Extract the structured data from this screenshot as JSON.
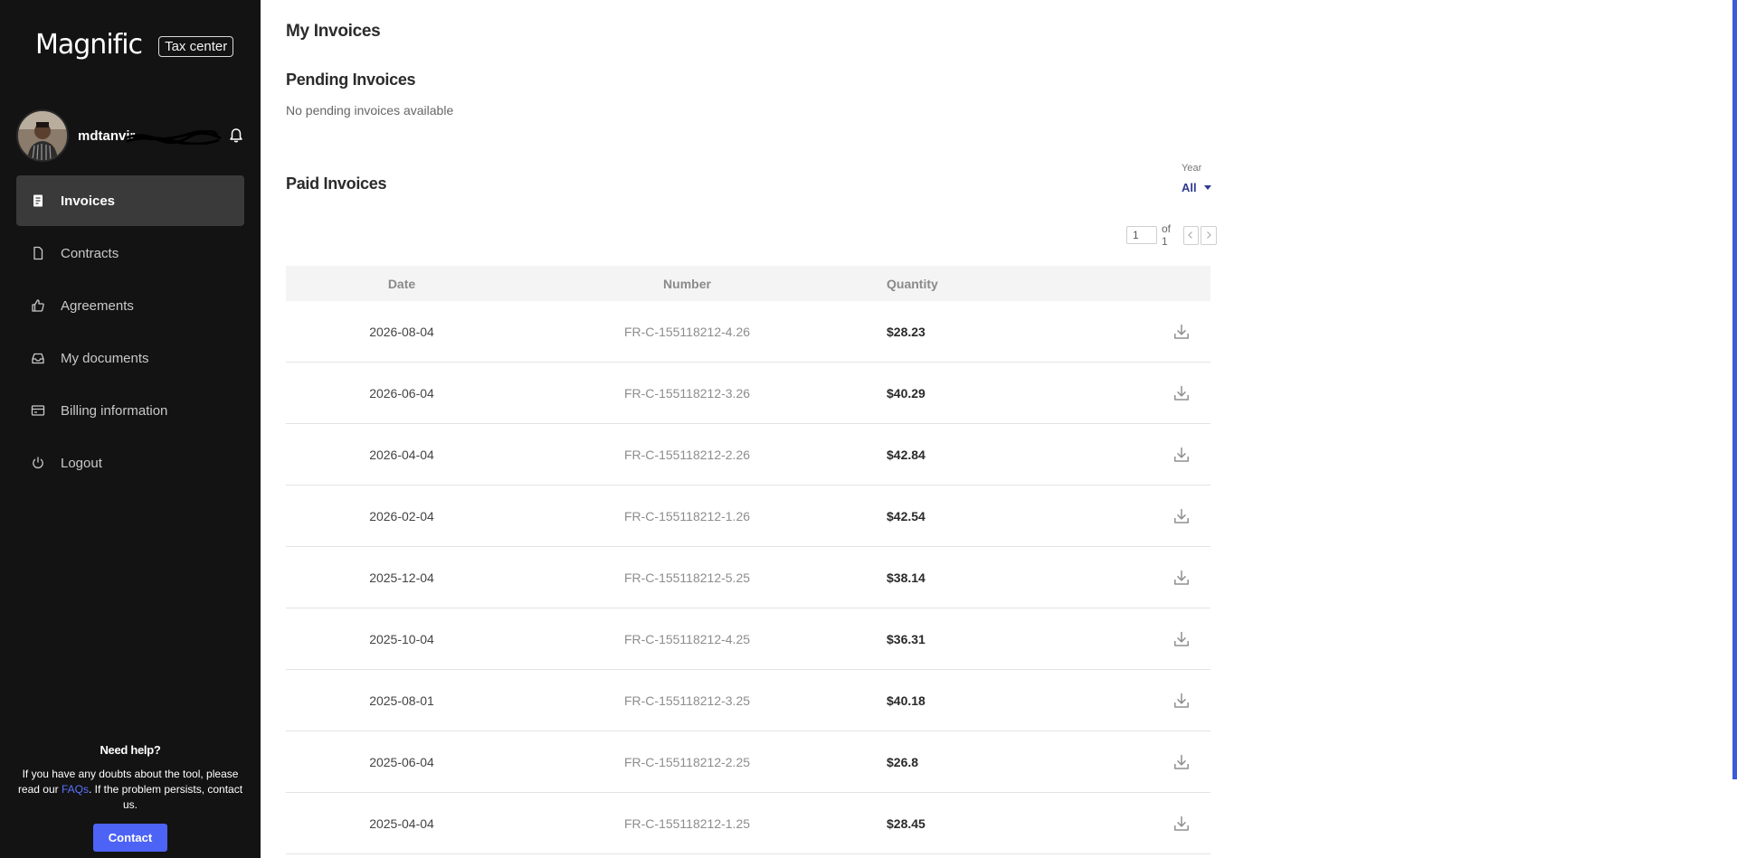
{
  "sidebar": {
    "brand": "Magnific",
    "badge": "Tax center",
    "user": {
      "name": "mdtanvir"
    },
    "nav": [
      {
        "label": "Invoices",
        "icon": "invoice-icon",
        "active": true
      },
      {
        "label": "Contracts",
        "icon": "document-icon",
        "active": false
      },
      {
        "label": "Agreements",
        "icon": "thumbs-up-icon",
        "active": false
      },
      {
        "label": "My documents",
        "icon": "inbox-icon",
        "active": false
      },
      {
        "label": "Billing information",
        "icon": "card-icon",
        "active": false
      },
      {
        "label": "Logout",
        "icon": "power-icon",
        "active": false
      }
    ],
    "help": {
      "title": "Need help?",
      "text_before": "If you have any doubts about the tool, please read our ",
      "faq_link": "FAQs",
      "text_after": ". If the problem persists, contact us.",
      "contact_button": "Contact"
    }
  },
  "main": {
    "title": "My Invoices",
    "pending": {
      "title": "Pending Invoices",
      "empty_text": "No pending invoices available"
    },
    "paid": {
      "title": "Paid Invoices",
      "year_filter": {
        "label": "Year",
        "value": "All"
      },
      "pager": {
        "current": "1",
        "of_text": "of 1"
      },
      "columns": [
        "Date",
        "Number",
        "Quantity"
      ],
      "rows": [
        {
          "date": "2026-08-04",
          "number": "FR-C-155118212-4.26",
          "quantity": "$28.23"
        },
        {
          "date": "2026-06-04",
          "number": "FR-C-155118212-3.26",
          "quantity": "$40.29"
        },
        {
          "date": "2026-04-04",
          "number": "FR-C-155118212-2.26",
          "quantity": "$42.84"
        },
        {
          "date": "2026-02-04",
          "number": "FR-C-155118212-1.26",
          "quantity": "$42.54"
        },
        {
          "date": "2025-12-04",
          "number": "FR-C-155118212-5.25",
          "quantity": "$38.14"
        },
        {
          "date": "2025-10-04",
          "number": "FR-C-155118212-4.25",
          "quantity": "$36.31"
        },
        {
          "date": "2025-08-01",
          "number": "FR-C-155118212-3.25",
          "quantity": "$40.18"
        },
        {
          "date": "2025-06-04",
          "number": "FR-C-155118212-2.25",
          "quantity": "$26.8"
        },
        {
          "date": "2025-04-04",
          "number": "FR-C-155118212-1.25",
          "quantity": "$28.45"
        }
      ]
    }
  },
  "colors": {
    "sidebar_bg": "#131313",
    "accent": "#4d63f5",
    "active_nav": "#3a3a3a"
  }
}
